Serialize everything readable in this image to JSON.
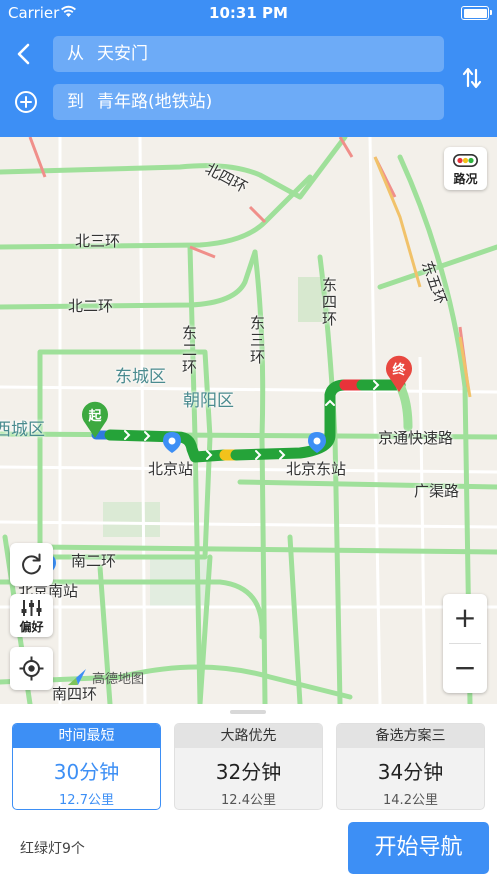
{
  "status_bar": {
    "carrier": "Carrier",
    "time": "10:31 PM"
  },
  "search": {
    "from_prefix": "从",
    "from_value": "天安门",
    "to_prefix": "到",
    "to_value": "青年路(地铁站)"
  },
  "map": {
    "traffic_button_label": "路况",
    "start_marker": "起",
    "end_marker": "终",
    "labels": {
      "north_4th_ring": "北四环",
      "north_3rd_ring": "北三环",
      "north_2nd_ring": "北二环",
      "east_2nd_ring": "东二环",
      "east_3rd_ring": "东三环",
      "east_4th_ring": "东四环",
      "east_5th_ring": "东五环",
      "dongcheng": "东城区",
      "chaoyang": "朝阳区",
      "xicheng": "西城区",
      "beijing_station": "北京站",
      "beijing_east_station": "北京东站",
      "jingtong_expressway": "京通快速路",
      "guangqu_road": "广渠路",
      "south_2nd_ring": "南二环",
      "beijing_south_station": "北京南站",
      "south_4th_ring": "南四环",
      "watermark": "高德地图"
    },
    "preference_label": "偏好",
    "zoom_in": "+",
    "zoom_out": "−"
  },
  "routes": [
    {
      "title": "时间最短",
      "duration": "30分钟",
      "distance": "12.7公里",
      "selected": true
    },
    {
      "title": "大路优先",
      "duration": "32分钟",
      "distance": "12.4公里",
      "selected": false
    },
    {
      "title": "备选方案三",
      "duration": "34分钟",
      "distance": "14.2公里",
      "selected": false
    }
  ],
  "footer": {
    "traffic_lights": "红绿灯9个",
    "start_button": "开始导航"
  },
  "colors": {
    "accent": "#3d8ff5",
    "route_smooth": "#2fb33f",
    "route_slow": "#f2c21b",
    "route_jam": "#e8333a"
  }
}
